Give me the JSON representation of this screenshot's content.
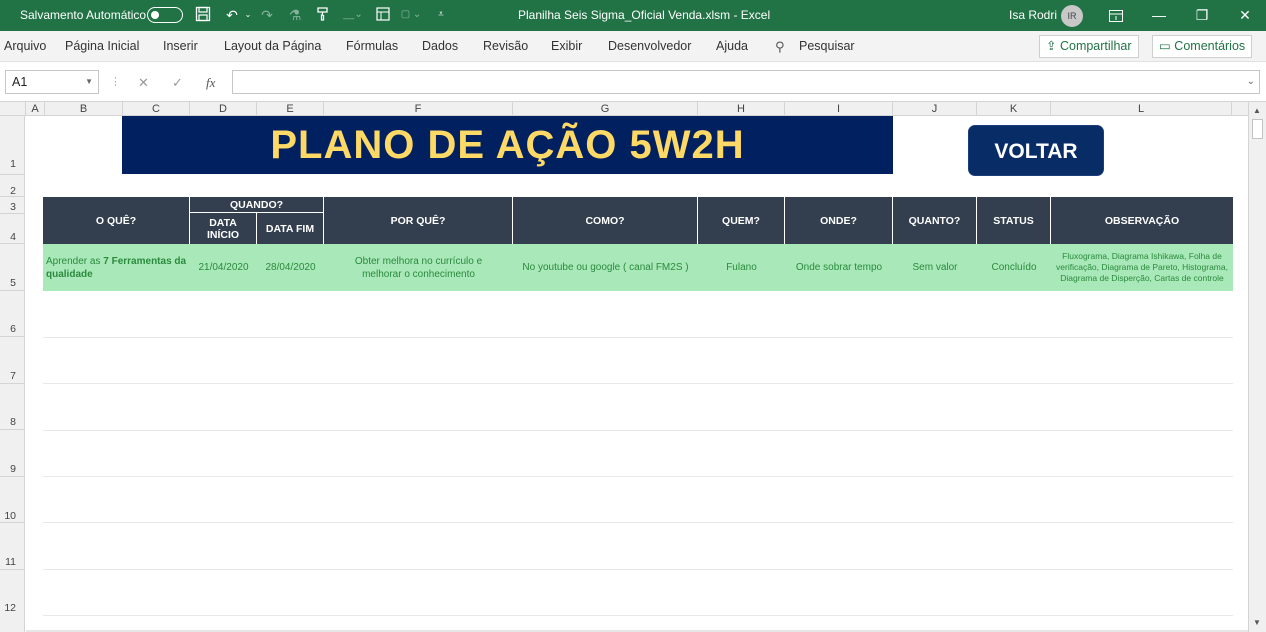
{
  "titlebar": {
    "autosave_label": "Salvamento Automático",
    "file_title": "Planilha Seis Sigma_Oficial Venda.xlsm  -  Excel",
    "user_name": "Isa Rodri",
    "user_initials": "IR"
  },
  "ribbon": {
    "tabs": [
      "Arquivo",
      "Página Inicial",
      "Inserir",
      "Layout da Página",
      "Fórmulas",
      "Dados",
      "Revisão",
      "Exibir",
      "Desenvolvedor",
      "Ajuda"
    ],
    "search_label": "Pesquisar",
    "share_label": "Compartilhar",
    "comments_label": "Comentários"
  },
  "formula_bar": {
    "name_box": "A1",
    "fx_label": "fx",
    "formula_value": ""
  },
  "columns": [
    "A",
    "B",
    "C",
    "D",
    "E",
    "F",
    "G",
    "H",
    "I",
    "J",
    "K",
    "L"
  ],
  "rows": [
    "1",
    "2",
    "3",
    "4",
    "5",
    "6",
    "7",
    "8",
    "9",
    "10",
    "11",
    "12"
  ],
  "sheet": {
    "banner_title": "PLANO DE AÇÃO 5W2H",
    "voltar_label": "VOLTAR",
    "headers": {
      "what": "O QUÊ?",
      "when": "QUANDO?",
      "start": "DATA INÍCIO",
      "end": "DATA FIM",
      "why": "POR QUÊ?",
      "how": "COMO?",
      "who": "QUEM?",
      "where": "ONDE?",
      "how_much": "QUANTO?",
      "status": "STATUS",
      "notes": "OBSERVAÇÃO"
    },
    "row": {
      "what_prefix": "Aprender as ",
      "what_bold": "7 Ferramentas da qualidade",
      "start": "21/04/2020",
      "end": "28/04/2020",
      "why": "Obter melhora no currículo e melhorar o conhecimento",
      "how": "No youtube ou google ( canal FM2S )",
      "who": "Fulano",
      "where": "Onde sobrar tempo",
      "how_much": "Sem valor",
      "status": "Concluído",
      "notes": "Fluxograma, Diagrama Ishikawa, Folha de verificação, Diagrama de Pareto, Histograma, Diagrama de Disperção, Cartas de controle"
    }
  },
  "colors": {
    "excel_green": "#217346",
    "banner_bg": "#002060",
    "banner_text": "#ffd966",
    "header_bg": "#333f4f",
    "row_bg": "#a9e8b8",
    "row_text": "#2b8a3e"
  }
}
